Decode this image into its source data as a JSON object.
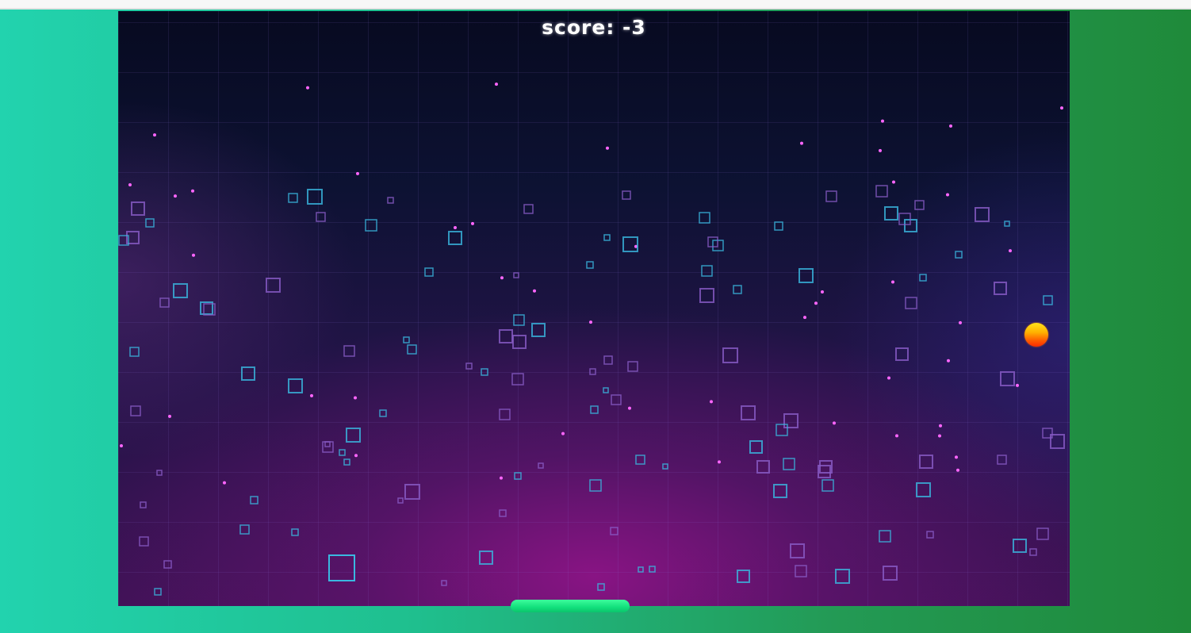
{
  "hud": {
    "score_label": "score:",
    "score_value": -3,
    "score_text": "score: -3"
  },
  "colors": {
    "ball": "#ff8c00",
    "paddle": "#14e884",
    "background_left": "#22d3ae",
    "background_right": "#1f8a3a"
  },
  "objects": {
    "ball": "ball",
    "paddle": "paddle"
  }
}
